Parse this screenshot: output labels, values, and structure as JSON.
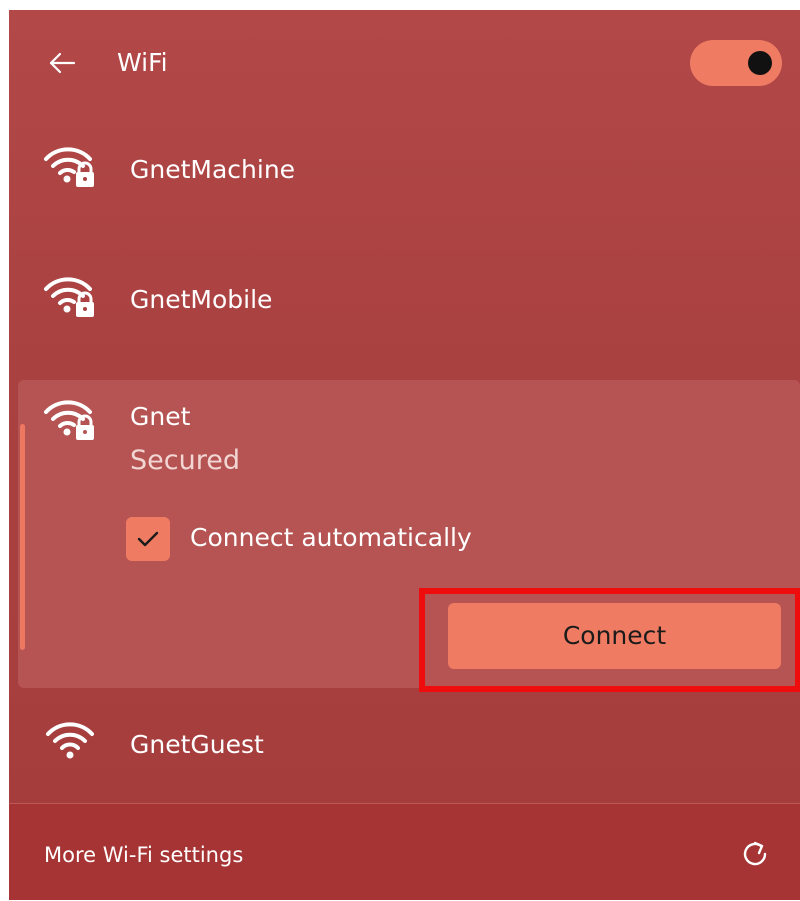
{
  "header": {
    "back_icon": "arrow-left-icon",
    "title": "WiFi",
    "wifi_enabled": true
  },
  "networks": [
    {
      "name": "GnetMachine",
      "secured": true,
      "icon": "wifi-lock-icon"
    },
    {
      "name": "GnetMobile",
      "secured": true,
      "icon": "wifi-lock-icon"
    },
    {
      "name": "Gnet",
      "status": "Secured",
      "secured": true,
      "expanded": true,
      "icon": "wifi-lock-icon",
      "connect_automatically_label": "Connect automatically",
      "connect_automatically_checked": true,
      "connect_label": "Connect"
    },
    {
      "name": "GnetGuest",
      "secured": false,
      "icon": "wifi-icon"
    }
  ],
  "footer": {
    "more_settings_label": "More Wi-Fi settings",
    "refresh_icon": "refresh-icon"
  },
  "colors": {
    "panel_background": "#aa4141",
    "accent": "#ef7c62",
    "expanded_card": "#b65353",
    "footer_background": "#a73434",
    "highlight_box": "#ee0c0c"
  }
}
